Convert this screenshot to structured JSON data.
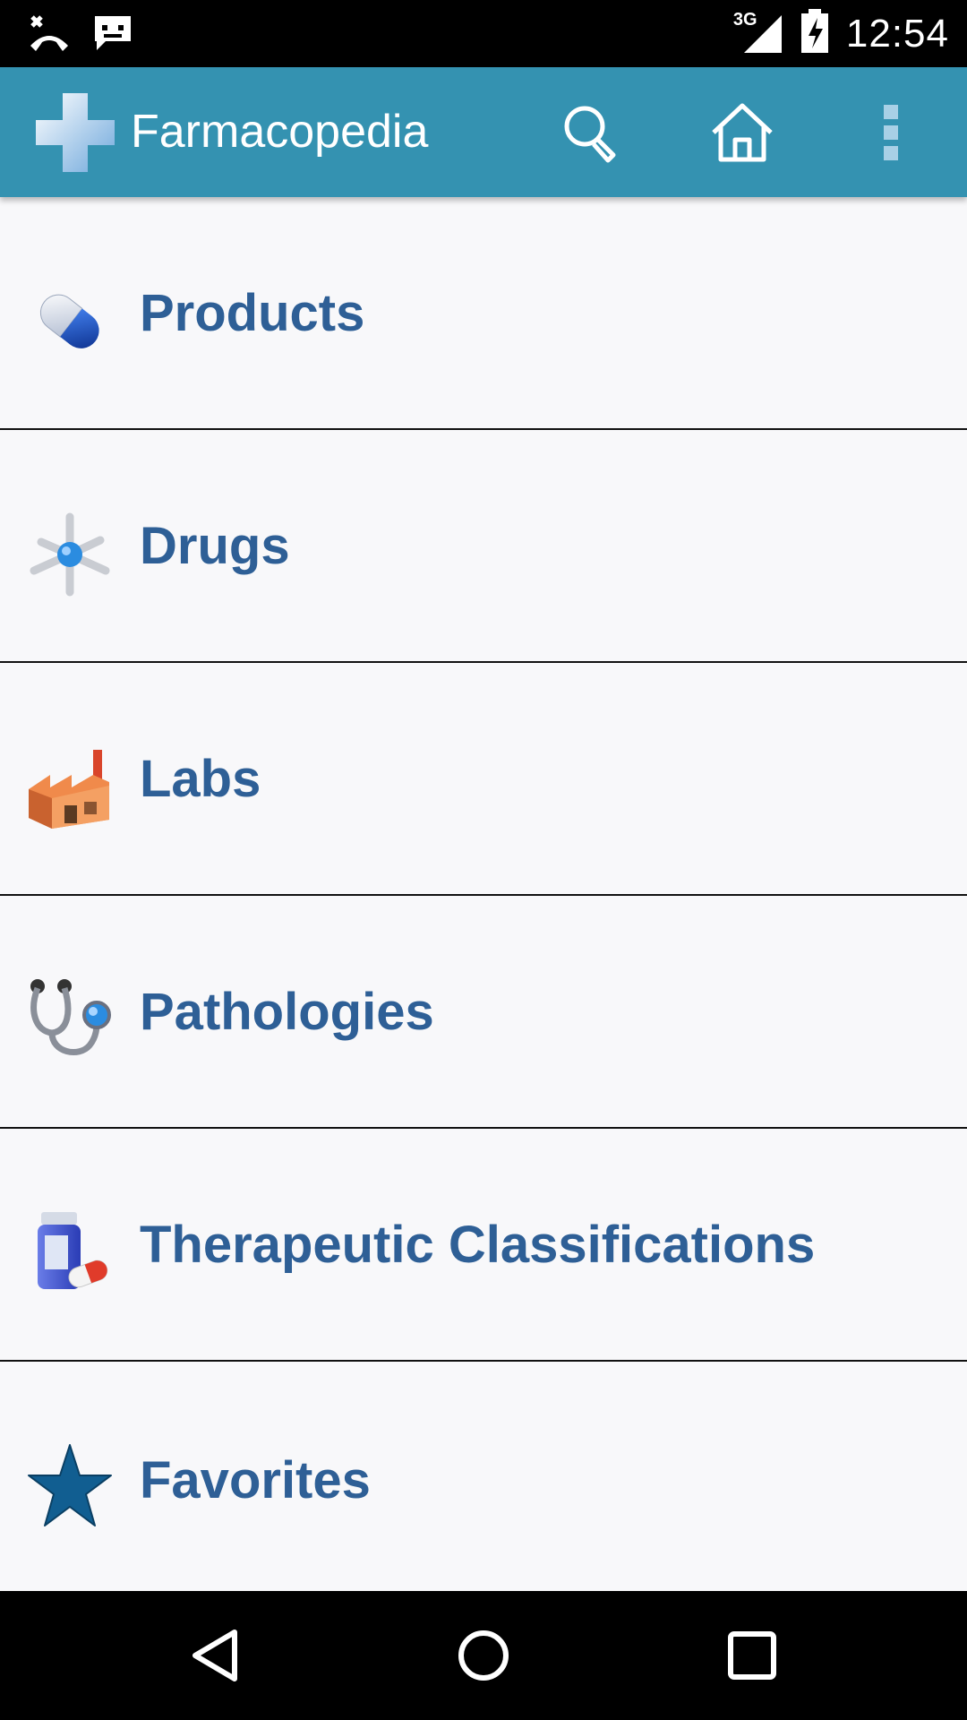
{
  "status_bar": {
    "time": "12:54",
    "network": "3G",
    "icons": [
      "missed-call-icon",
      "message-icon",
      "signal-icon",
      "battery-icon"
    ]
  },
  "app_bar": {
    "title": "Farmacopedia",
    "background": "#3492b1",
    "actions": [
      "search-icon",
      "home-icon",
      "overflow-menu-icon"
    ]
  },
  "menu": {
    "items": [
      {
        "label": "Products",
        "icon": "capsule-icon"
      },
      {
        "label": "Drugs",
        "icon": "molecule-icon"
      },
      {
        "label": "Labs",
        "icon": "factory-icon"
      },
      {
        "label": "Pathologies",
        "icon": "stethoscope-icon"
      },
      {
        "label": "Therapeutic Classifications",
        "icon": "medicine-bottle-icon"
      },
      {
        "label": "Favorites",
        "icon": "star-icon"
      }
    ],
    "label_color": "#2e5f96"
  },
  "nav_bar": {
    "buttons": [
      "back-icon",
      "home-circle-icon",
      "recents-icon"
    ]
  }
}
